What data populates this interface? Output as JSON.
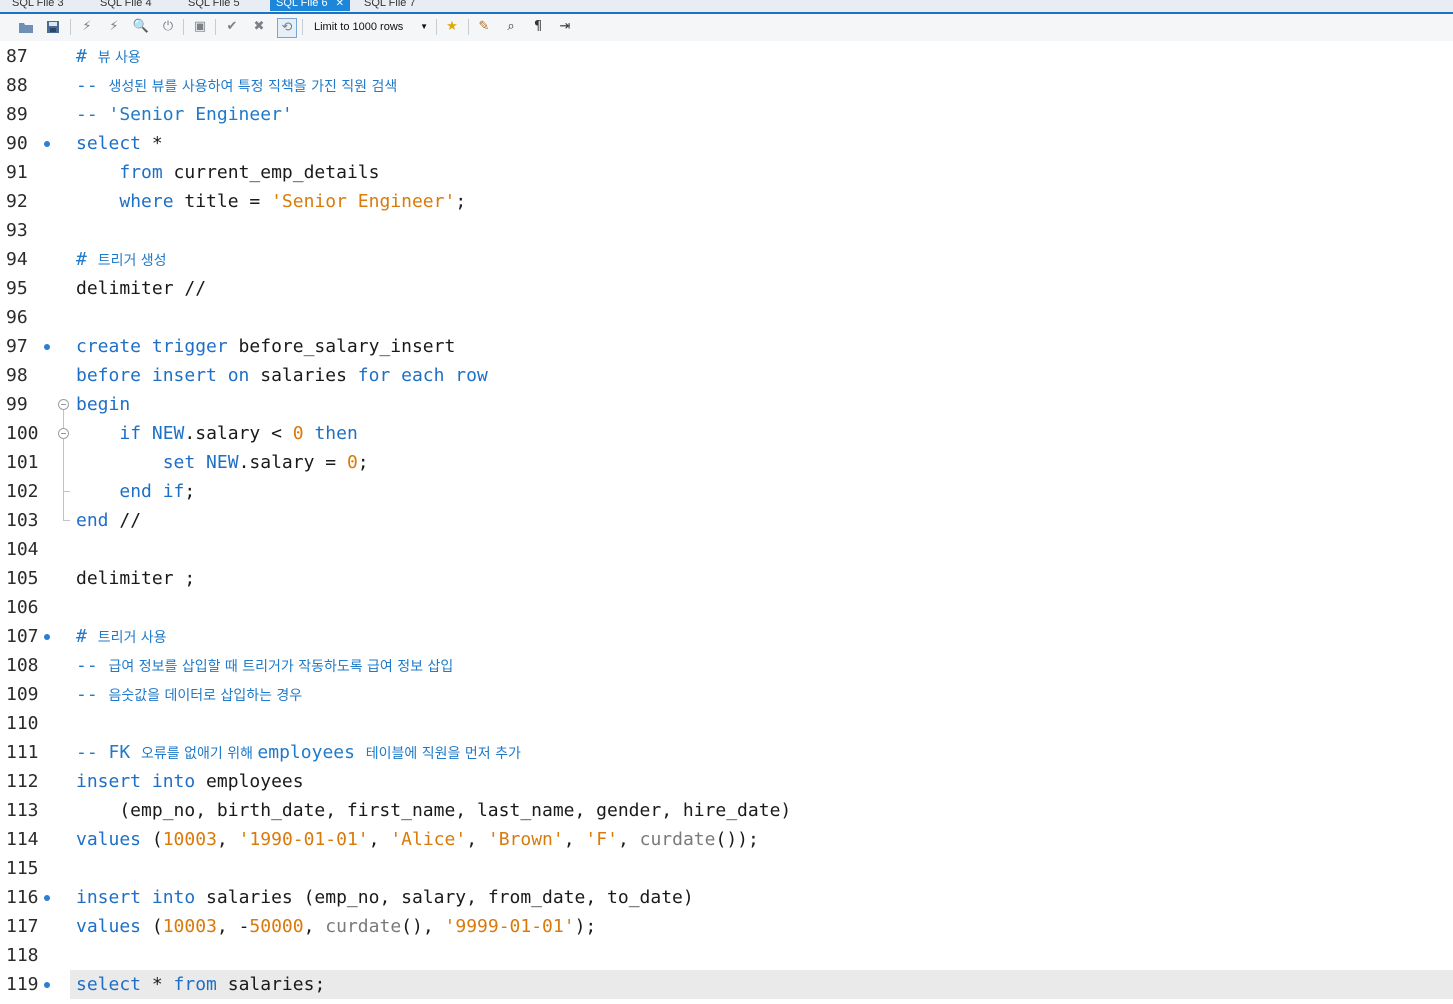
{
  "tabs": [
    {
      "label": "SQL File 3",
      "active": false
    },
    {
      "label": "SQL File 4",
      "active": false
    },
    {
      "label": "SQL File 5",
      "active": false
    },
    {
      "label": "SQL File 6",
      "active": true
    },
    {
      "label": "SQL File 7",
      "active": false
    }
  ],
  "toolbar": {
    "limit_label": "Limit to 1000 rows",
    "buttons": [
      "open-folder-icon",
      "save-icon",
      "execute-icon",
      "execute-current-icon",
      "explain-icon",
      "stop-icon",
      "toggle-results-icon",
      "commit-icon",
      "rollback-icon",
      "autocommit-icon",
      "bookmark-icon",
      "beautify-icon",
      "find-icon",
      "invisible-chars-icon",
      "wrap-icon"
    ]
  },
  "colors": {
    "keyword": "#1e6fc7",
    "comment": "#1f7ac9",
    "string": "#d97a0a",
    "function": "#7a7a7a",
    "tab_active": "#1e86d8"
  },
  "editor": {
    "current_line": 119,
    "lines": [
      {
        "n": "87",
        "m": false,
        "t": [
          [
            "cm",
            "# "
          ],
          [
            "cmk",
            "뷰 사용"
          ]
        ]
      },
      {
        "n": "88",
        "m": false,
        "t": [
          [
            "cm",
            "-- "
          ],
          [
            "cmk",
            "생성된 뷰를 사용하여 특정 직책을 가진 직원 검색"
          ]
        ]
      },
      {
        "n": "89",
        "m": false,
        "t": [
          [
            "cm",
            "-- 'Senior Engineer'"
          ]
        ]
      },
      {
        "n": "90",
        "m": true,
        "t": [
          [
            "kw",
            "select"
          ],
          [
            "pl",
            " *"
          ]
        ]
      },
      {
        "n": "91",
        "m": false,
        "t": [
          [
            "pl",
            "    "
          ],
          [
            "kw",
            "from"
          ],
          [
            "pl",
            " current_emp_details"
          ]
        ]
      },
      {
        "n": "92",
        "m": false,
        "t": [
          [
            "pl",
            "    "
          ],
          [
            "kw",
            "where"
          ],
          [
            "pl",
            " title = "
          ],
          [
            "str",
            "'Senior Engineer'"
          ],
          [
            "pl",
            ";"
          ]
        ]
      },
      {
        "n": "93",
        "m": false,
        "t": []
      },
      {
        "n": "94",
        "m": false,
        "t": [
          [
            "cm",
            "# "
          ],
          [
            "cmk",
            "트리거 생성"
          ]
        ]
      },
      {
        "n": "95",
        "m": false,
        "t": [
          [
            "pl",
            "delimiter //"
          ]
        ]
      },
      {
        "n": "96",
        "m": false,
        "t": []
      },
      {
        "n": "97",
        "m": true,
        "t": [
          [
            "kw",
            "create trigger"
          ],
          [
            "pl",
            " before_salary_insert"
          ]
        ]
      },
      {
        "n": "98",
        "m": false,
        "t": [
          [
            "kw",
            "before insert on"
          ],
          [
            "pl",
            " salaries "
          ],
          [
            "kw",
            "for each row"
          ]
        ]
      },
      {
        "n": "99",
        "m": false,
        "t": [
          [
            "kw",
            "begin"
          ]
        ]
      },
      {
        "n": "100",
        "m": false,
        "t": [
          [
            "pl",
            "    "
          ],
          [
            "kw",
            "if NEW"
          ],
          [
            "pl",
            ".salary < "
          ],
          [
            "num",
            "0"
          ],
          [
            "kw",
            " then"
          ]
        ]
      },
      {
        "n": "101",
        "m": false,
        "t": [
          [
            "pl",
            "        "
          ],
          [
            "kw",
            "set NEW"
          ],
          [
            "pl",
            ".salary = "
          ],
          [
            "num",
            "0"
          ],
          [
            "pl",
            ";"
          ]
        ]
      },
      {
        "n": "102",
        "m": false,
        "t": [
          [
            "pl",
            "    "
          ],
          [
            "kw",
            "end if"
          ],
          [
            "pl",
            ";"
          ]
        ]
      },
      {
        "n": "103",
        "m": false,
        "t": [
          [
            "kw",
            "end"
          ],
          [
            "pl",
            " //"
          ]
        ]
      },
      {
        "n": "104",
        "m": false,
        "t": []
      },
      {
        "n": "105",
        "m": false,
        "t": [
          [
            "pl",
            "delimiter ;"
          ]
        ]
      },
      {
        "n": "106",
        "m": false,
        "t": []
      },
      {
        "n": "107",
        "m": true,
        "t": [
          [
            "cm",
            "# "
          ],
          [
            "cmk",
            "트리거 사용"
          ]
        ]
      },
      {
        "n": "108",
        "m": false,
        "t": [
          [
            "cm",
            "-- "
          ],
          [
            "cmk",
            "급여 정보를 삽입할 때 트리거가 작동하도록 급여 정보 삽입"
          ]
        ]
      },
      {
        "n": "109",
        "m": false,
        "t": [
          [
            "cm",
            "-- "
          ],
          [
            "cmk",
            "음숫값을 데이터로 삽입하는 경우"
          ]
        ]
      },
      {
        "n": "110",
        "m": false,
        "t": []
      },
      {
        "n": "111",
        "m": false,
        "t": [
          [
            "cm",
            "-- FK "
          ],
          [
            "cmk",
            "오류를 없애기 위해 "
          ],
          [
            "cm",
            "employees "
          ],
          [
            "cmk",
            "테이블에 직원을 먼저 추가"
          ]
        ]
      },
      {
        "n": "112",
        "m": false,
        "t": [
          [
            "kw",
            "insert into"
          ],
          [
            "pl",
            " employees"
          ]
        ]
      },
      {
        "n": "113",
        "m": false,
        "t": [
          [
            "pl",
            "    (emp_no, birth_date, first_name, last_name, gender, hire_date)"
          ]
        ]
      },
      {
        "n": "114",
        "m": false,
        "t": [
          [
            "kw",
            "values"
          ],
          [
            "pl",
            " ("
          ],
          [
            "num",
            "10003"
          ],
          [
            "pl",
            ", "
          ],
          [
            "str",
            "'1990-01-01'"
          ],
          [
            "pl",
            ", "
          ],
          [
            "str",
            "'Alice'"
          ],
          [
            "pl",
            ", "
          ],
          [
            "str",
            "'Brown'"
          ],
          [
            "pl",
            ", "
          ],
          [
            "str",
            "'F'"
          ],
          [
            "pl",
            ", "
          ],
          [
            "fn",
            "curdate"
          ],
          [
            "pl",
            "());"
          ]
        ]
      },
      {
        "n": "115",
        "m": false,
        "t": []
      },
      {
        "n": "116",
        "m": true,
        "t": [
          [
            "kw",
            "insert into"
          ],
          [
            "pl",
            " salaries (emp_no, salary, from_date, to_date)"
          ]
        ]
      },
      {
        "n": "117",
        "m": false,
        "t": [
          [
            "kw",
            "values"
          ],
          [
            "pl",
            " ("
          ],
          [
            "num",
            "10003"
          ],
          [
            "pl",
            ", -"
          ],
          [
            "num",
            "50000"
          ],
          [
            "pl",
            ", "
          ],
          [
            "fn",
            "curdate"
          ],
          [
            "pl",
            "(), "
          ],
          [
            "str",
            "'9999-01-01'"
          ],
          [
            "pl",
            ");"
          ]
        ]
      },
      {
        "n": "118",
        "m": false,
        "t": []
      },
      {
        "n": "119",
        "m": true,
        "t": [
          [
            "kw",
            "select"
          ],
          [
            "pl",
            " * "
          ],
          [
            "kw",
            "from"
          ],
          [
            "pl",
            " salaries;"
          ]
        ]
      }
    ]
  }
}
